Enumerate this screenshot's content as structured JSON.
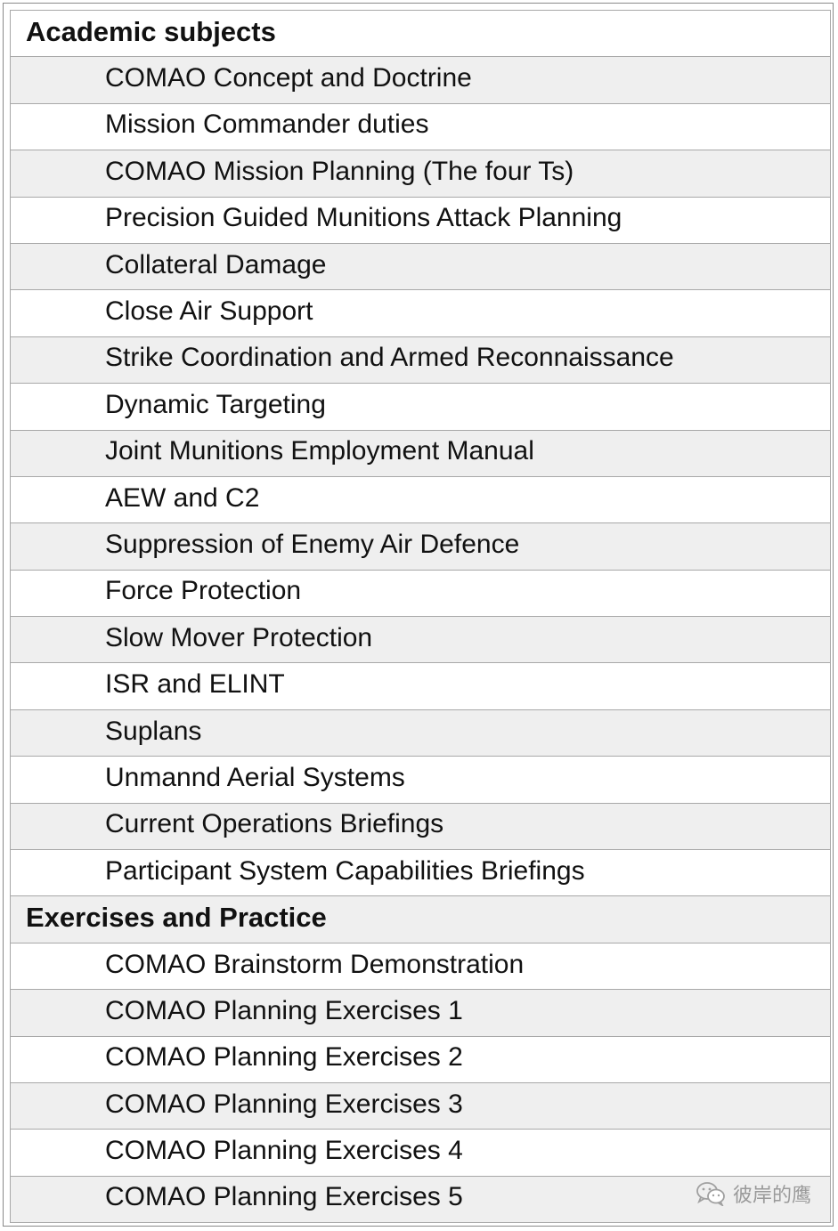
{
  "sections": [
    {
      "title": "Academic subjects",
      "items": [
        "COMAO Concept and Doctrine",
        "Mission Commander duties",
        "COMAO Mission Planning (The four Ts)",
        "Precision Guided Munitions Attack Planning",
        "Collateral Damage",
        "Close Air Support",
        "Strike Coordination and Armed Reconnaissance",
        "Dynamic Targeting",
        "Joint Munitions Employment Manual",
        "AEW and C2",
        "Suppression of Enemy Air Defence",
        "Force Protection",
        "Slow Mover Protection",
        "ISR and ELINT",
        "Suplans",
        "Unmannd Aerial Systems",
        "Current Operations Briefings",
        "Participant System Capabilities Briefings"
      ]
    },
    {
      "title": "Exercises and Practice",
      "items": [
        "COMAO Brainstorm Demonstration",
        "COMAO Planning Exercises 1",
        "COMAO Planning Exercises 2",
        "COMAO Planning Exercises 3",
        "COMAO Planning Exercises 4",
        "COMAO Planning Exercises 5"
      ]
    }
  ],
  "watermark": {
    "text": "彼岸的鹰",
    "icon": "wechat-icon"
  }
}
